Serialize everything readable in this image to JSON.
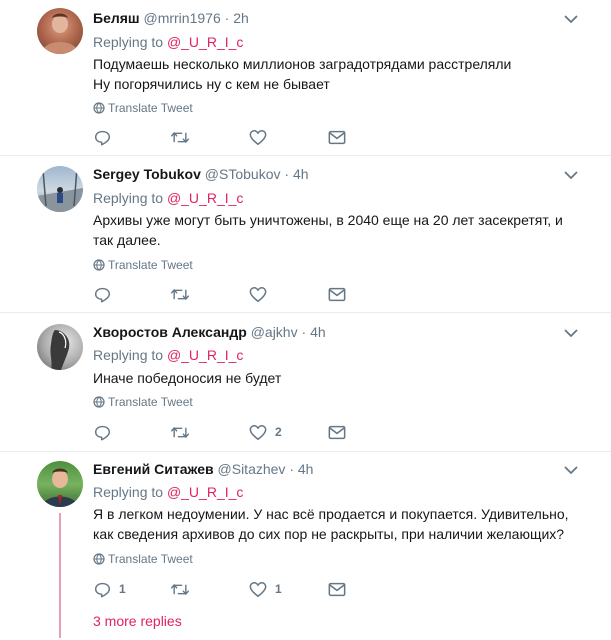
{
  "tweets": [
    {
      "name": "Беляш",
      "handle": "@mrrin1976",
      "sep": "·",
      "time": "2h",
      "reply_prefix": "Replying to",
      "reply_to": "@_U_R_I_c",
      "text_lines": [
        "Подумаешь несколько миллионов заградотрядами расстреляли",
        "Ну погорячились ну с кем не бывает"
      ],
      "translate": "Translate Tweet",
      "counts": {
        "reply": "",
        "retweet": "",
        "like": ""
      }
    },
    {
      "name": "Sergey Tobukov",
      "handle": "@STobukov",
      "sep": "·",
      "time": "4h",
      "reply_prefix": "Replying to",
      "reply_to": "@_U_R_I_c",
      "text_lines": [
        "Архивы уже могут быть уничтожены, в 2040 еще на 20 лет засекретят, и так далее."
      ],
      "translate": "Translate Tweet",
      "counts": {
        "reply": "",
        "retweet": "",
        "like": ""
      }
    },
    {
      "name": "Хворостов Александр",
      "handle": "@ajkhv",
      "sep": "·",
      "time": "4h",
      "reply_prefix": "Replying to",
      "reply_to": "@_U_R_I_c",
      "text_lines": [
        "Иначе победоносия не будет"
      ],
      "translate": "Translate Tweet",
      "counts": {
        "reply": "",
        "retweet": "",
        "like": "2"
      }
    },
    {
      "name": "Евгений Ситажев",
      "handle": "@Sitazhev",
      "sep": "·",
      "time": "4h",
      "reply_prefix": "Replying to",
      "reply_to": "@_U_R_I_c",
      "text_lines": [
        "Я в легком недоумении. У нас всё продается и покупается. Удивительно, как сведения архивов до сих пор не раскрыты, при наличии желающих?"
      ],
      "translate": "Translate Tweet",
      "counts": {
        "reply": "1",
        "retweet": "",
        "like": "1"
      }
    }
  ],
  "more_replies": "3 more replies",
  "colors": {
    "accent": "#e0245e",
    "muted": "#657786",
    "text": "#14171a",
    "divider": "#e6ecf0"
  }
}
